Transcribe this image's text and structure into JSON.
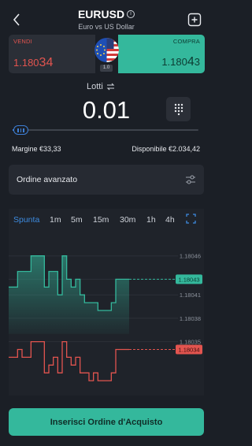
{
  "header": {
    "symbol": "EURUSD",
    "subtitle": "Euro vs US Dollar",
    "info_glyph": "i",
    "back_icon": "chevron-left-icon",
    "add_icon": "add-watchlist-icon"
  },
  "quote": {
    "sell_label": "VENDI",
    "sell_price_main": "1.180",
    "sell_price_big": "34",
    "buy_label": "COMPRA",
    "buy_price_main": "1.180",
    "buy_price_big": "4",
    "buy_price_tail": "3",
    "spread": "1.0",
    "flag_icon": "eu-us-flag-icon"
  },
  "lots": {
    "label": "Lotti",
    "value": "0.01",
    "swap_icon": "swap-icon",
    "keypad_icon": "keypad-icon",
    "slider_level": 0.03
  },
  "margin": {
    "margin_text": "Margine €33,33",
    "available_text": "Disponibile €2.034,42"
  },
  "advanced": {
    "label": "Ordine avanzato",
    "icon": "sliders-icon"
  },
  "timeframes": [
    {
      "label": "Spunta",
      "active": true
    },
    {
      "label": "1m",
      "active": false
    },
    {
      "label": "5m",
      "active": false
    },
    {
      "label": "15m",
      "active": false
    },
    {
      "label": "30m",
      "active": false
    },
    {
      "label": "1h",
      "active": false
    },
    {
      "label": "4h",
      "active": false
    }
  ],
  "chart_data": {
    "type": "line",
    "y_ticks": [
      "1.18046",
      "1.18043",
      "1.18041",
      "1.18038",
      "1.18035"
    ],
    "buy_marker": "1.18043",
    "sell_marker": "1.18034",
    "colors": {
      "buy": "#34b89c",
      "sell": "#e2544f"
    },
    "series": [
      {
        "values": [
          1.18042,
          1.18042,
          1.18044,
          1.18044,
          1.18044,
          1.18046,
          1.18046,
          1.18046,
          1.18042,
          1.18044,
          1.18044,
          1.18041,
          1.18046,
          1.18043,
          1.18042,
          1.18043,
          1.18041,
          1.1804,
          1.1804,
          1.1804,
          1.18039,
          1.18039,
          1.18039,
          1.1804,
          1.18043,
          1.18043,
          1.18043,
          1.18043
        ]
      },
      {
        "values": [
          1.18033,
          1.18033,
          1.18034,
          1.18033,
          1.18033,
          1.18035,
          1.18035,
          1.18035,
          1.18031,
          1.18032,
          1.18033,
          1.18031,
          1.18035,
          1.18033,
          1.18032,
          1.18033,
          1.18031,
          1.18031,
          1.1803,
          1.18031,
          1.1803,
          1.1803,
          1.1803,
          1.18031,
          1.18034,
          1.18034,
          1.18034,
          1.18034
        ]
      }
    ]
  },
  "cta": {
    "label": "Inserisci Ordine d'Acquisto"
  }
}
